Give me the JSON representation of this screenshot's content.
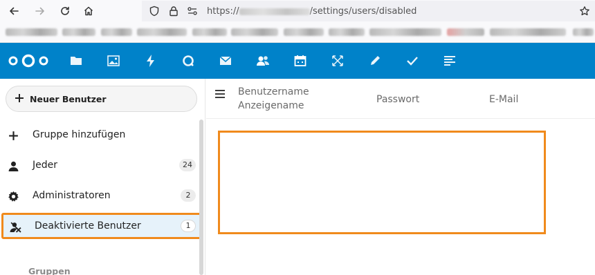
{
  "browser": {
    "url_prefix": "https://",
    "url_suffix": "/settings/users/disabled"
  },
  "header": {
    "app_icons": [
      "files-icon",
      "photos-icon",
      "activity-icon",
      "talk-icon",
      "mail-icon",
      "contacts-icon",
      "calendar-icon",
      "deck-icon",
      "notes-icon",
      "tasks-icon",
      "more-apps-icon"
    ],
    "brand_color": "#0082c9"
  },
  "sidebar": {
    "new_user_label": "Neuer Benutzer",
    "items": [
      {
        "label": "Gruppe hinzufügen",
        "icon": "plus-icon",
        "count": ""
      },
      {
        "label": "Jeder",
        "icon": "user-icon",
        "count": "24"
      },
      {
        "label": "Administratoren",
        "icon": "gear-icon",
        "count": "2"
      },
      {
        "label": "Deaktivierte Benutzer",
        "icon": "disabled-user-icon",
        "count": "1"
      }
    ],
    "section_label": "Gruppen",
    "highlight_color": "#f08a1c"
  },
  "table": {
    "col_username": "Benutzername",
    "col_displayname": "Anzeigename",
    "col_password": "Passwort",
    "col_email": "E-Mail"
  }
}
